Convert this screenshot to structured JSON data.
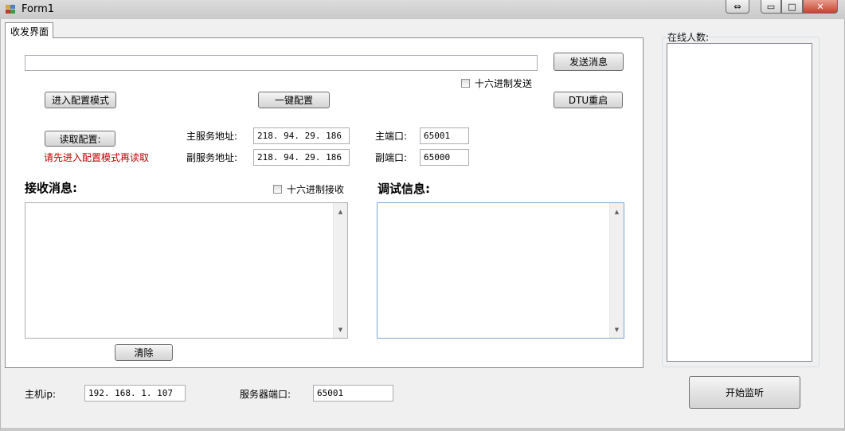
{
  "window": {
    "title": "Form1",
    "controls": {
      "restore": "⇔",
      "minimize": "▭",
      "maximize": "□",
      "close": "✕"
    }
  },
  "tabs": [
    {
      "label": "收发界面"
    }
  ],
  "send": {
    "message_value": "",
    "send_button": "发送消息",
    "hex_send_label": "十六进制发送",
    "hex_send_checked": false
  },
  "config": {
    "enter_config_button": "进入配置模式",
    "one_key_config_button": "一键配置",
    "dtu_restart_button": "DTU重启",
    "read_config_button": "读取配置:",
    "warning_text": "请先进入配置模式再读取",
    "main_server_label": "主服务地址:",
    "main_server_value": "218. 94. 29. 186",
    "sub_server_label": "副服务地址:",
    "sub_server_value": "218. 94. 29. 186",
    "main_port_label": "主端口:",
    "main_port_value": "65001",
    "sub_port_label": "副端口:",
    "sub_port_value": "65000"
  },
  "receive": {
    "title": "接收消息:",
    "hex_receive_label": "十六进制接收",
    "hex_receive_checked": false,
    "clear_button": "清除"
  },
  "debug": {
    "title": "调试信息:"
  },
  "online": {
    "label": "在线人数:"
  },
  "footer": {
    "host_ip_label": "主机ip:",
    "host_ip_value": "192. 168. 1. 107",
    "server_port_label": "服务器端口:",
    "server_port_value": "65001",
    "start_listen_button": "开始监听"
  },
  "colors": {
    "warning": "#c00000",
    "panel": "#ffffff",
    "window_bg": "#f0f0f0"
  }
}
